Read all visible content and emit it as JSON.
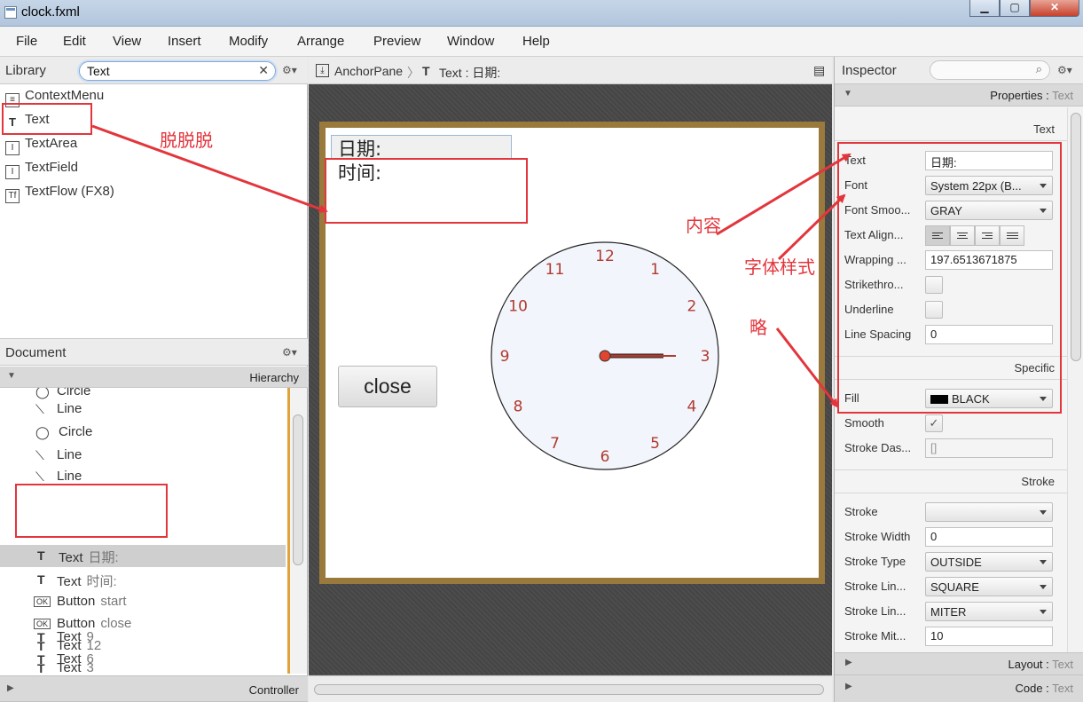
{
  "window": {
    "title": "clock.fxml",
    "minimize_label": "▁",
    "maximize_label": "▢",
    "close_label": "✕"
  },
  "menu": [
    "File",
    "Edit",
    "View",
    "Insert",
    "Modify",
    "Arrange",
    "Preview",
    "Window",
    "Help"
  ],
  "library": {
    "title": "Library",
    "search_value": "Text",
    "items": [
      {
        "label": "ContextMenu",
        "icon": "context-menu-icon"
      },
      {
        "label": "Text",
        "icon": "text-icon"
      },
      {
        "label": "TextArea",
        "icon": "text-area-icon"
      },
      {
        "label": "TextField",
        "icon": "text-field-icon"
      },
      {
        "label": "TextFlow  (FX8)",
        "icon": "text-flow-icon"
      }
    ]
  },
  "document": {
    "title": "Document",
    "hierarchy_label": "Hierarchy",
    "controller_label": "Controller",
    "rows": [
      {
        "type": "Circle",
        "detail": "",
        "icon": "circle-icon"
      },
      {
        "type": "Line",
        "detail": "",
        "icon": "line-icon"
      },
      {
        "type": "Circle",
        "detail": "",
        "icon": "circle-icon"
      },
      {
        "type": "Line",
        "detail": "",
        "icon": "line-icon"
      },
      {
        "type": "Line",
        "detail": "",
        "icon": "line-icon"
      },
      {
        "type": "Text",
        "detail": "日期:",
        "icon": "text-icon"
      },
      {
        "type": "Text",
        "detail": "时间:",
        "icon": "text-icon"
      },
      {
        "type": "Button",
        "detail": "start",
        "icon": "button-icon"
      },
      {
        "type": "Button",
        "detail": "close",
        "icon": "button-icon"
      },
      {
        "type": "Text",
        "detail": "12",
        "icon": "text-icon"
      },
      {
        "type": "Text",
        "detail": "3",
        "icon": "text-icon"
      },
      {
        "type": "Text",
        "detail": "9",
        "icon": "text-icon"
      },
      {
        "type": "Text",
        "detail": "6",
        "icon": "text-icon"
      }
    ]
  },
  "breadcrumb": {
    "root": "AnchorPane",
    "current": "Text : 日期:"
  },
  "canvas": {
    "date_label": "日期:",
    "time_label": "时间:",
    "close_button": "close",
    "clock_numbers": [
      "12",
      "1",
      "2",
      "3",
      "4",
      "5",
      "6",
      "7",
      "8",
      "9",
      "10",
      "11"
    ],
    "colors": {
      "frame": "#9a7a3c",
      "clock_face": "#f2f5fb",
      "numbers": "#b03a2e",
      "hand": "#b03a2e"
    }
  },
  "inspector": {
    "title": "Inspector",
    "properties_header": {
      "label": "Properties",
      "sep": " : ",
      "node": "Text"
    },
    "section_text": "Text",
    "text_value": "日期:",
    "font": "System 22px (B...",
    "font_smoothing": "GRAY",
    "wrapping_width": "197.6513671875",
    "line_spacing": "0",
    "section_specific": "Specific",
    "fill": "BLACK",
    "stroke_dash": "[]",
    "section_stroke": "Stroke",
    "stroke_width": "0",
    "stroke_type": "OUTSIDE",
    "stroke_line_cap": "SQUARE",
    "stroke_line_join": "MITER",
    "stroke_miter": "10",
    "layout_header": {
      "label": "Layout",
      "sep": " : ",
      "node": "Text"
    },
    "code_header": {
      "label": "Code",
      "sep": " : ",
      "node": "Text"
    },
    "labels": {
      "text": "Text",
      "font": "Font",
      "font_smoothing": "Font Smoo...",
      "text_alignment": "Text Align...",
      "wrapping": "Wrapping ...",
      "strikethrough": "Strikethro...",
      "underline": "Underline",
      "line_spacing": "Line Spacing",
      "fill": "Fill",
      "smooth": "Smooth",
      "stroke_dash": "Stroke Das...",
      "stroke": "Stroke",
      "stroke_width": "Stroke Width",
      "stroke_type": "Stroke Type",
      "stroke_line_cap": "Stroke Lin...",
      "stroke_line_join": "Stroke Lin...",
      "stroke_miter": "Stroke Mit..."
    }
  },
  "annotations": {
    "tuo": "脱脱脱",
    "content": "内容",
    "font_style": "字体样式",
    "omit": "略",
    "color": "#e3353c"
  }
}
